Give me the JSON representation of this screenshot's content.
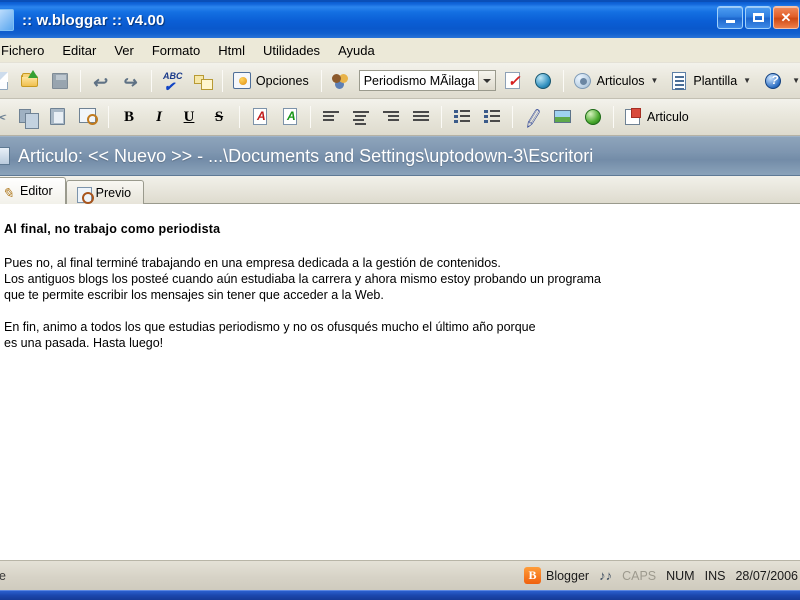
{
  "window": {
    "title": ":: w.bloggar :: v4.00",
    "icon": "app-icon",
    "controls": {
      "minimize": "_",
      "maximize": "□",
      "close": "✕"
    }
  },
  "menubar": {
    "items": [
      {
        "label": "Fichero"
      },
      {
        "label": "Editar"
      },
      {
        "label": "Ver"
      },
      {
        "label": "Formato"
      },
      {
        "label": "Html"
      },
      {
        "label": "Utilidades"
      },
      {
        "label": "Ayuda"
      }
    ]
  },
  "toolbar_main": {
    "buttons": [
      {
        "name": "new-document",
        "label": ""
      },
      {
        "name": "open-document",
        "label": ""
      },
      {
        "name": "save-document",
        "label": ""
      },
      {
        "name": "undo",
        "label": ""
      },
      {
        "name": "redo",
        "label": ""
      },
      {
        "name": "spellcheck",
        "label": ""
      },
      {
        "name": "find-replace",
        "label": ""
      },
      {
        "name": "options",
        "label": "Opciones"
      },
      {
        "name": "accounts",
        "label": ""
      }
    ],
    "options_label": "Opciones",
    "account_combo": {
      "value": "Periodismo MÃilaga",
      "name": "account-selector"
    },
    "post_button": "",
    "publish_button": "",
    "articulos_label": "Articulos",
    "plantilla_label": "Plantilla",
    "help_label": ""
  },
  "toolbar_format": {
    "bold": "B",
    "italic": "I",
    "underline": "U",
    "strike": "S",
    "articulo_label": "Articulo"
  },
  "article_bar": {
    "text": "Articulo: << Nuevo >> - ...\\Documents and Settings\\uptodown-3\\Escritori"
  },
  "tabs": [
    {
      "label": "Editor",
      "active": true,
      "name": "tab-editor"
    },
    {
      "label": "Previo",
      "active": false,
      "name": "tab-previo"
    }
  ],
  "editor": {
    "title": "Al final, no trabajo como periodista",
    "paragraphs": [
      "Pues no, al final terminé trabajando en una empresa dedicada a la gestión de contenidos.\nLos antiguos blogs los posteé cuando aún estudiaba la carrera y ahora mismo estoy probando un programa\nque te permite escribir los mensajes sin tener que acceder a la Web.",
      "En fin, animo a todos los que estudias periodismo y no os ofusqués mucho el último año porque\nes una pasada. Hasta luego!"
    ]
  },
  "statusbar": {
    "left_text": "ne",
    "blogger_label": "Blogger",
    "caps": "CAPS",
    "num": "NUM",
    "ins": "INS",
    "date": "28/07/2006"
  },
  "colors": {
    "titlebar_blue": "#0b5fd6",
    "article_bar": "#7e96b0",
    "toolbar_bg": "#e9e7dc",
    "menubar_bg": "#ece9d8",
    "editor_bg": "#ffffff",
    "blogger_orange": "#f0600d",
    "taskbar_blue": "#1b47ad"
  }
}
